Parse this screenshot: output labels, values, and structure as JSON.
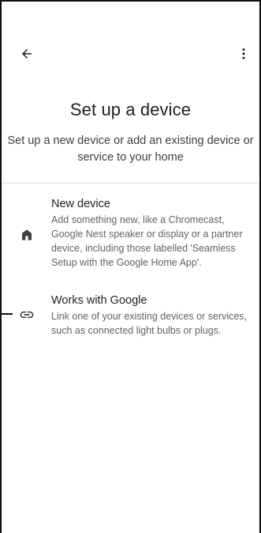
{
  "header": {
    "back_icon": "arrow-back-icon",
    "more_icon": "more-vert-icon"
  },
  "page": {
    "title": "Set up a device",
    "subtitle": "Set up a new device or add an existing device or service to your home"
  },
  "options": [
    {
      "icon": "home-icon",
      "title": "New device",
      "description": "Add something new, like a Chromecast, Google Nest speaker or display or a partner device, including those labelled 'Seamless Setup with the Google Home App'."
    },
    {
      "icon": "link-icon",
      "title": "Works with Google",
      "description": "Link one of your existing devices or services, such as connected light bulbs or plugs."
    }
  ],
  "colors": {
    "text_primary": "#202124",
    "text_secondary": "#5f6368",
    "divider": "#dadce0",
    "icon": "#3c4043"
  }
}
